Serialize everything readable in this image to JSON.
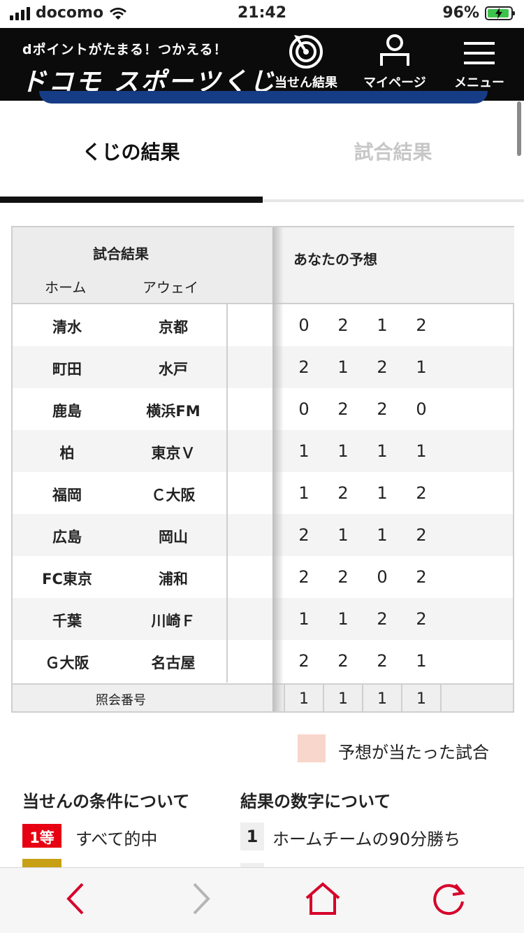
{
  "status_bar": {
    "carrier": "docomo",
    "time": "21:42",
    "battery": "96%"
  },
  "header": {
    "tagline": "dポイントがたまる！つかえる！",
    "brand": "ドコモ スポーツくじ",
    "nav": {
      "result": "当せん結果",
      "mypage": "マイページ",
      "menu": "メニュー"
    }
  },
  "tabs": {
    "kuji": "くじの結果",
    "match": "試合結果"
  },
  "table": {
    "header": {
      "title": "試合結果",
      "home": "ホーム",
      "away": "アウェイ",
      "yours": "あなたの予想"
    },
    "rows": [
      {
        "home": "清水",
        "away": "京都",
        "picks": [
          "0",
          "2",
          "1",
          "2"
        ]
      },
      {
        "home": "町田",
        "away": "水戸",
        "picks": [
          "2",
          "1",
          "2",
          "1"
        ]
      },
      {
        "home": "鹿島",
        "away": "横浜FM",
        "picks": [
          "0",
          "2",
          "2",
          "0"
        ]
      },
      {
        "home": "柏",
        "away": "東京Ｖ",
        "picks": [
          "1",
          "1",
          "1",
          "1"
        ]
      },
      {
        "home": "福岡",
        "away": "Ｃ大阪",
        "picks": [
          "1",
          "2",
          "1",
          "2"
        ]
      },
      {
        "home": "広島",
        "away": "岡山",
        "picks": [
          "2",
          "1",
          "1",
          "2"
        ]
      },
      {
        "home": "FC東京",
        "away": "浦和",
        "picks": [
          "2",
          "2",
          "0",
          "2"
        ]
      },
      {
        "home": "千葉",
        "away": "川崎Ｆ",
        "picks": [
          "1",
          "1",
          "2",
          "2"
        ]
      },
      {
        "home": "Ｇ大阪",
        "away": "名古屋",
        "picks": [
          "2",
          "2",
          "2",
          "1"
        ]
      }
    ],
    "footer": {
      "label": "照会番号",
      "values": [
        "1",
        "1",
        "1",
        "1"
      ]
    }
  },
  "legend": {
    "text": "予想が当たった試合",
    "color": "#f8d6cb"
  },
  "conditions": {
    "title": "当せんの条件について",
    "badge": "1等",
    "item": "すべて的中"
  },
  "numbers": {
    "title": "結果の数字について",
    "num": "1",
    "item": "ホームチームの90分勝ち"
  },
  "colors": {
    "accent_red": "#e60012",
    "header_bg": "#0b0b0b",
    "nav_red": "#d6002a"
  }
}
